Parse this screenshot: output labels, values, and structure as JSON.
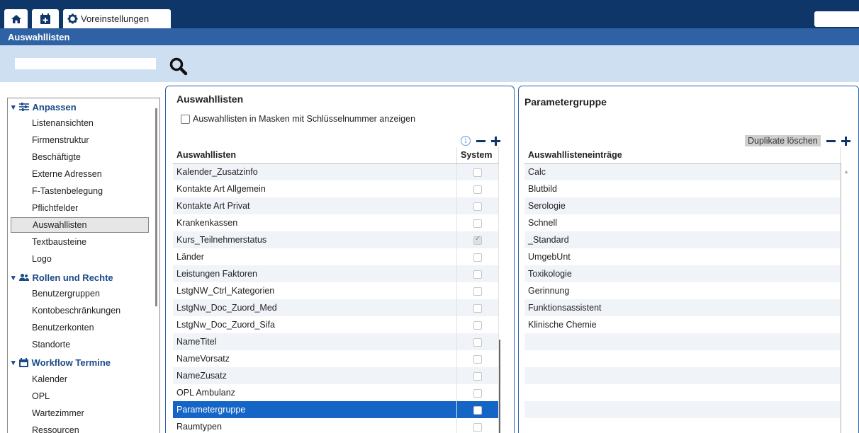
{
  "topbar": {
    "tabs": [
      {
        "label": "Voreinstellungen"
      }
    ]
  },
  "title": "Auswahllisten",
  "search": {
    "placeholder": "",
    "value": ""
  },
  "sidebar": {
    "groups": [
      {
        "label": "Anpassen",
        "items": [
          "Listenansichten",
          "Firmenstruktur",
          "Beschäftigte",
          "Externe Adressen",
          "F-Tastenbelegung",
          "Pflichtfelder",
          "Auswahllisten",
          "Textbausteine",
          "Logo"
        ]
      },
      {
        "label": "Rollen und Rechte",
        "items": [
          "Benutzergruppen",
          "Kontobeschränkungen",
          "Benutzerkonten",
          "Standorte"
        ]
      },
      {
        "label": "Workflow Termine",
        "items": [
          "Kalender",
          "OPL",
          "Wartezimmer",
          "Ressourcen"
        ]
      }
    ],
    "active_item": "Auswahllisten"
  },
  "left_panel": {
    "title": "Auswahllisten",
    "checkbox_label": "Auswahllisten in Masken mit Schlüsselnummer anzeigen",
    "columns": [
      "Auswahllisten",
      "System"
    ],
    "rows": [
      {
        "name": "Kalender_Zusatzinfo",
        "system": false
      },
      {
        "name": "Kontakte Art Allgemein",
        "system": false
      },
      {
        "name": "Kontakte Art Privat",
        "system": false
      },
      {
        "name": "Krankenkassen",
        "system": false
      },
      {
        "name": "Kurs_Teilnehmerstatus",
        "system": true
      },
      {
        "name": "Länder",
        "system": false
      },
      {
        "name": "Leistungen Faktoren",
        "system": false
      },
      {
        "name": "LstgNW_Ctrl_Kategorien",
        "system": false
      },
      {
        "name": "LstgNw_Doc_Zuord_Med",
        "system": false
      },
      {
        "name": "LstgNw_Doc_Zuord_Sifa",
        "system": false
      },
      {
        "name": "NameTitel",
        "system": false
      },
      {
        "name": "NameVorsatz",
        "system": false
      },
      {
        "name": "NameZusatz",
        "system": false
      },
      {
        "name": "OPL Ambulanz",
        "system": false
      },
      {
        "name": "Parametergruppe",
        "system": false,
        "selected": true
      },
      {
        "name": "Raumtypen",
        "system": false
      }
    ]
  },
  "right_panel": {
    "title": "Parametergruppe",
    "duplicate_button": "Duplikate löschen",
    "column": "Auswahllisteneinträge",
    "rows": [
      "Calc",
      "Blutbild",
      "Serologie",
      "Schnell",
      "_Standard",
      "UmgebUnt",
      "Toxikologie",
      "Gerinnung",
      "Funktionsassistent",
      "Klinische Chemie",
      "",
      "",
      "",
      "",
      "",
      ""
    ]
  },
  "colors": {
    "topbar": "#0f3669",
    "titlebar": "#2f62a4",
    "searchbar": "#cfdff2",
    "selection": "#1565c6"
  }
}
